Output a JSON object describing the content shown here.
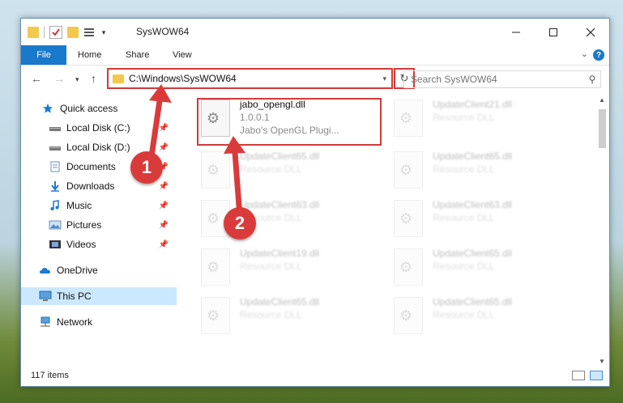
{
  "titlebar": {
    "title": "SysWOW64",
    "minimize_icon": "minimize-icon",
    "maximize_icon": "maximize-icon",
    "close_icon": "close-icon"
  },
  "ribbon": {
    "file_label": "File",
    "tabs": [
      "Home",
      "Share",
      "View"
    ],
    "help_glyph": "?"
  },
  "nav": {
    "address_path": "C:\\Windows\\SysWOW64",
    "search_placeholder": "Search SysWOW64"
  },
  "sidebar": {
    "items": [
      {
        "label": "Quick access",
        "icon": "star-icon"
      },
      {
        "label": "Local Disk (C:)",
        "icon": "drive-icon",
        "pinned": true
      },
      {
        "label": "Local Disk (D:)",
        "icon": "drive-icon",
        "pinned": true
      },
      {
        "label": "Documents",
        "icon": "documents-icon",
        "pinned": true
      },
      {
        "label": "Downloads",
        "icon": "download-icon",
        "pinned": true
      },
      {
        "label": "Music",
        "icon": "music-icon",
        "pinned": true
      },
      {
        "label": "Pictures",
        "icon": "pictures-icon",
        "pinned": true
      },
      {
        "label": "Videos",
        "icon": "videos-icon",
        "pinned": true
      },
      {
        "label": "OneDrive",
        "icon": "cloud-icon"
      },
      {
        "label": "This PC",
        "icon": "computer-icon",
        "selected": true
      },
      {
        "label": "Network",
        "icon": "network-icon"
      }
    ]
  },
  "files": {
    "highlighted": {
      "name": "jabo_opengl.dll",
      "version": "1.0.0.1",
      "description": "Jabo's OpenGL Plugi..."
    },
    "others": [
      {
        "name": "UpdateClient21.dll",
        "type": "Resource DLL"
      },
      {
        "name": "UpdateClient65.dll",
        "type": "Resource DLL"
      },
      {
        "name": "UpdateClient65.dll",
        "type": "Resource DLL"
      },
      {
        "name": "UpdateClient63.dll",
        "type": "Resource DLL"
      },
      {
        "name": "UpdateClient63.dll",
        "type": "Resource DLL"
      },
      {
        "name": "UpdateClient19.dll",
        "type": "Resource DLL"
      },
      {
        "name": "UpdateClient65.dll",
        "type": "Resource DLL"
      },
      {
        "name": "UpdateClient65.dll",
        "type": "Resource DLL"
      },
      {
        "name": "UpdateClient65.dll",
        "type": "Resource DLL"
      }
    ]
  },
  "status": {
    "item_count": "117 items"
  },
  "annotations": {
    "step1": "1",
    "step2": "2",
    "color": "#d93b3b"
  }
}
